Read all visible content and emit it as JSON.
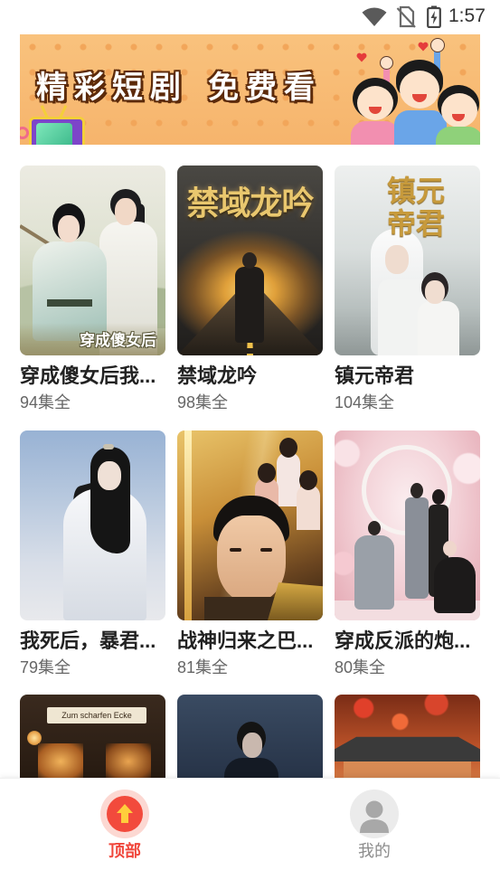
{
  "status_bar": {
    "time": "1:57",
    "icons": [
      "wifi-icon",
      "no-sim-icon",
      "battery-charging-icon"
    ]
  },
  "banner": {
    "headline_left": "精彩短剧",
    "headline_right": "免费看",
    "background_color": "#f6b46c"
  },
  "dramas": [
    {
      "title": "穿成傻女后我...",
      "episodes": "94集全",
      "poster_text": "穿成傻女后"
    },
    {
      "title": "禁域龙吟",
      "episodes": "98集全",
      "poster_text": "禁域龙吟"
    },
    {
      "title": "镇元帝君",
      "episodes": "104集全",
      "poster_text": "镇元帝君"
    },
    {
      "title": "我死后，暴君...",
      "episodes": "79集全"
    },
    {
      "title": "战神归来之巴...",
      "episodes": "81集全"
    },
    {
      "title": "穿成反派的炮...",
      "episodes": "80集全"
    },
    {
      "poster_text": "Zum scharfen Ecke"
    },
    {},
    {}
  ],
  "bottom_nav": {
    "items": [
      {
        "label": "顶部",
        "icon": "arrow-up-icon",
        "active": true
      },
      {
        "label": "我的",
        "icon": "user-avatar-icon",
        "active": false
      }
    ]
  },
  "colors": {
    "accent": "#f0463b",
    "inactive": "#8c8c8c",
    "title_text": "#222222",
    "subtitle_text": "#666666"
  }
}
